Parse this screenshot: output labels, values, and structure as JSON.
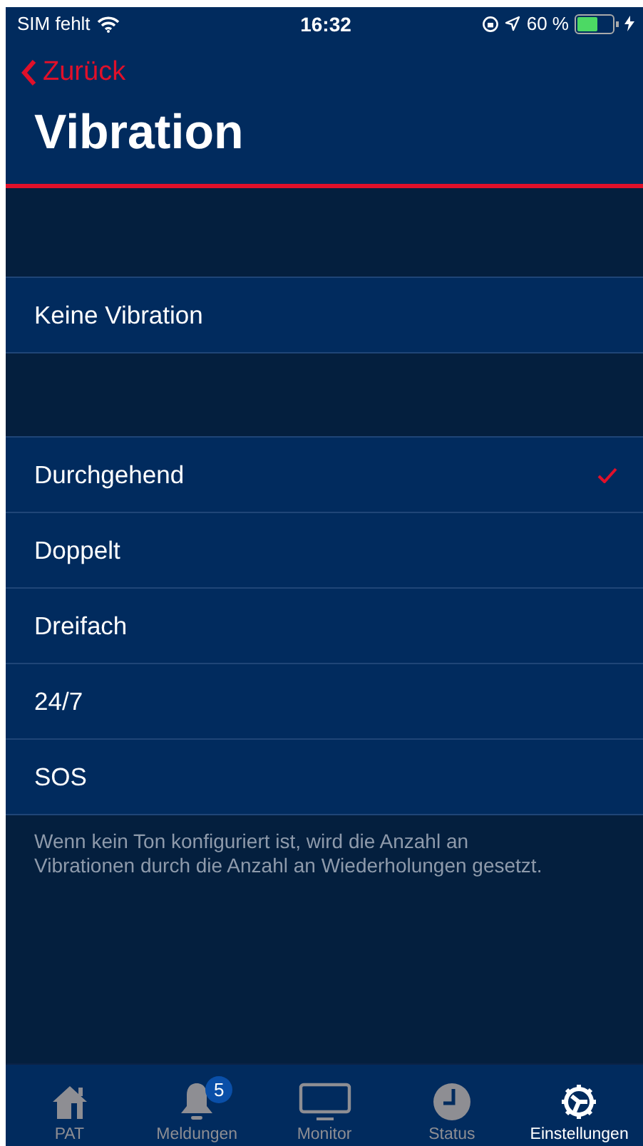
{
  "status_bar": {
    "carrier": "SIM fehlt",
    "time": "16:32",
    "battery": "60 %",
    "level": 0.6
  },
  "nav": {
    "back": "Zurück",
    "title": "Vibration"
  },
  "sections": [
    {
      "items": [
        {
          "label": "Keine Vibration",
          "selected": false
        }
      ]
    },
    {
      "items": [
        {
          "label": "Durchgehend",
          "selected": true
        },
        {
          "label": "Doppelt",
          "selected": false
        },
        {
          "label": "Dreifach",
          "selected": false
        },
        {
          "label": "24/7",
          "selected": false
        },
        {
          "label": "SOS",
          "selected": false
        }
      ],
      "footer": "Wenn kein Ton konfiguriert ist, wird die Anzahl an Vibrationen durch die Anzahl an Wiederholungen gesetzt."
    }
  ],
  "tab_bar": [
    {
      "kind": "home",
      "label": "PAT",
      "selected": false
    },
    {
      "kind": "bell",
      "label": "Meldungen",
      "selected": false,
      "badge": "5"
    },
    {
      "kind": "monitor",
      "label": "Monitor",
      "selected": false
    },
    {
      "kind": "clock",
      "label": "Status",
      "selected": false
    },
    {
      "kind": "gear",
      "label": "Einstellungen",
      "selected": true
    }
  ]
}
